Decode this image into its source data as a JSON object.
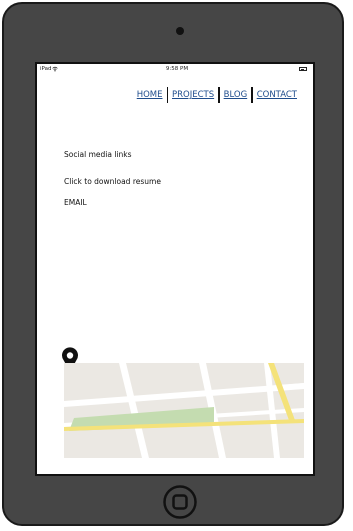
{
  "status_bar": {
    "carrier": "iPad",
    "time": "9:58 PM"
  },
  "nav": {
    "home": "HOME",
    "projects": "PROJECTS",
    "blog": "BLOG",
    "contact": "CONTACT"
  },
  "content": {
    "social": "Social media links",
    "resume": "Click to download resume",
    "email": "EMAIL"
  },
  "icons": [
    "wifi-icon",
    "battery-icon",
    "map-pin-icon",
    "home-button-icon"
  ],
  "colors": {
    "device_frame": "#464646",
    "link": "#1e4c8c",
    "map_road_yellow": "#f4e27a",
    "map_park": "#c4dcb0"
  }
}
